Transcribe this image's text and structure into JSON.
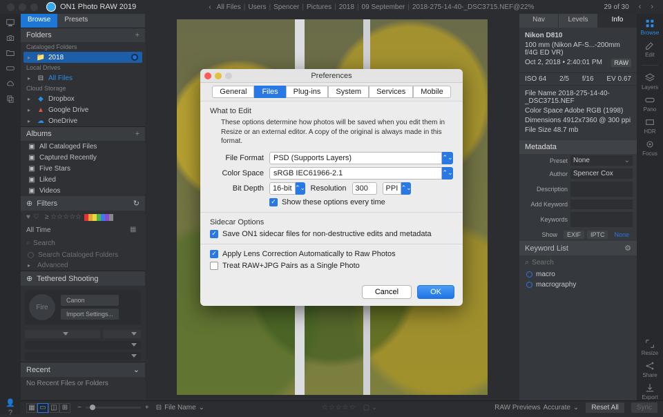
{
  "app": {
    "name": "ON1 Photo RAW 2019"
  },
  "breadcrumbs": [
    "All Files",
    "Users",
    "Spencer",
    "Pictures",
    "2018",
    "09 September",
    "2018-275-14-40-_DSC3715.NEF@22%"
  ],
  "page_counter": "29 of 30",
  "left_tabs": {
    "browse": "Browse",
    "presets": "Presets"
  },
  "folders": {
    "title": "Folders",
    "cataloged": "Cataloged Folders",
    "cat_item": "2018",
    "local": "Local Drives",
    "local_item": "All Files",
    "cloud": "Cloud Storage",
    "cloud_items": [
      "Dropbox",
      "Google Drive",
      "OneDrive"
    ]
  },
  "albums": {
    "title": "Albums",
    "items": [
      "All Cataloged Files",
      "Captured Recently",
      "Five Stars",
      "Liked",
      "Videos"
    ]
  },
  "filters": {
    "title": "Filters",
    "range": "All Time",
    "search_ph": "Search",
    "scf": "Search Cataloged Folders",
    "adv": "Advanced"
  },
  "tether": {
    "title": "Tethered Shooting",
    "fire": "Fire",
    "canon": "Canon",
    "import": "Import Settings..."
  },
  "recent": {
    "title": "Recent",
    "empty": "No Recent Files or Folders"
  },
  "right_tabs": {
    "nav": "Nav",
    "levels": "Levels",
    "info": "Info"
  },
  "info": {
    "camera": "Nikon D810",
    "lens": "100 mm (Nikon AF-S...-200mm f/4G ED VR)",
    "datetime": "Oct 2, 2018 • 2:40:01 PM",
    "raw_badge": "RAW",
    "iso": "ISO 64",
    "shutter": "2/5",
    "aperture": "f/16",
    "ev": "EV 0.67",
    "file_name_lbl": "File Name",
    "file_name": "2018-275-14-40-_DSC3715.NEF",
    "color_space_lbl": "Color Space",
    "color_space": "Adobe RGB (1998)",
    "dimensions_lbl": "Dimensions",
    "dimensions": "4912x7360 @ 300 ppi",
    "file_size_lbl": "File Size",
    "file_size": "48.7 mb"
  },
  "metadata": {
    "title": "Metadata",
    "preset_lbl": "Preset",
    "preset": "None",
    "author_lbl": "Author",
    "author": "Spencer Cox",
    "desc_lbl": "Description",
    "add_kw_lbl": "Add Keyword",
    "kws_lbl": "Keywords",
    "show_lbl": "Show",
    "show_opts": [
      "EXIF",
      "IPTC",
      "None"
    ]
  },
  "keywords": {
    "title": "Keyword List",
    "search_ph": "Search",
    "items": [
      "macro",
      "macrography"
    ]
  },
  "right_rail": [
    "Browse",
    "Edit",
    "Layers",
    "Pano",
    "HDR",
    "Focus",
    "Resize",
    "Share",
    "Export"
  ],
  "bottom": {
    "sort_lbl": "File Name",
    "raw_prev": "RAW Previews",
    "accurate": "Accurate",
    "reset": "Reset All",
    "sync": "Sync"
  },
  "modal": {
    "title": "Preferences",
    "tabs": [
      "General",
      "Files",
      "Plug-ins",
      "System",
      "Services",
      "Mobile"
    ],
    "what_to_edit": "What to Edit",
    "desc": "These options determine how photos will be saved when you edit them in Resize or an external editor.  A copy of the original is always made in this format.",
    "file_format_lbl": "File Format",
    "file_format": "PSD (Supports Layers)",
    "color_space_lbl": "Color Space",
    "color_space": "sRGB IEC61966-2.1",
    "bit_depth_lbl": "Bit Depth",
    "bit_depth": "16-bit",
    "res_lbl": "Resolution",
    "res_val": "300",
    "res_unit": "PPI",
    "show_every": "Show these options every time",
    "sidecar_title": "Sidecar Options",
    "sidecar_chk": "Save ON1 sidecar files for non-destructive edits and metadata",
    "lens_chk": "Apply Lens Correction Automatically to Raw Photos",
    "rawjpg_chk": "Treat RAW+JPG Pairs as a Single Photo",
    "cancel": "Cancel",
    "ok": "OK"
  }
}
